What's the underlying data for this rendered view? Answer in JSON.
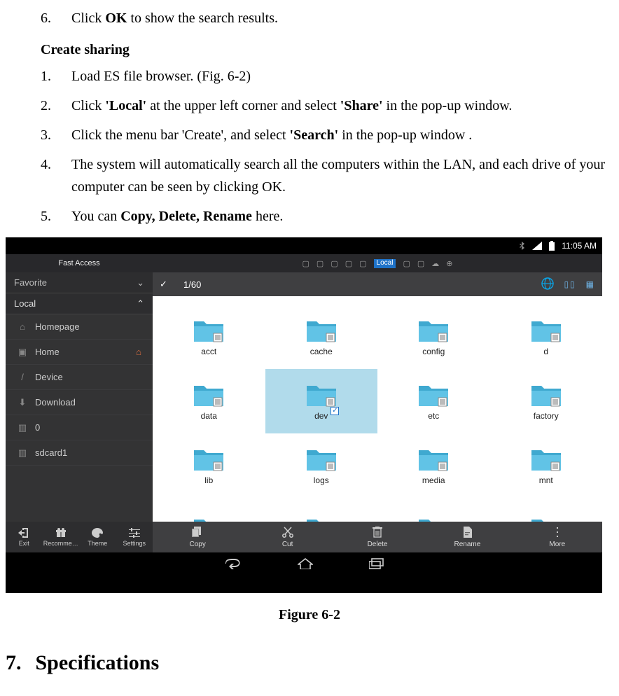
{
  "doc": {
    "step6": {
      "num": "6.",
      "pre": "Click ",
      "bold": "OK",
      "post": " to show the search results."
    },
    "create_heading": "Create sharing",
    "steps": [
      {
        "num": "1.",
        "text": "Load ES file browser. (Fig. 6-2)"
      },
      {
        "num": "2.",
        "pre": "Click ",
        "b1": "'Local'",
        "mid": " at the upper left corner and select ",
        "b2": "'Share'",
        "post": " in the pop-up window."
      },
      {
        "num": "3.",
        "pre": "Click the menu bar 'Create', and select ",
        "b1": "'Search'",
        "post": " in the pop-up window ."
      },
      {
        "num": "4.",
        "text": "The system will automatically search all the computers within the LAN, and each drive of your computer can be seen by clicking OK."
      },
      {
        "num": "5.",
        "pre": "You can ",
        "b1": "Copy, Delete, Rename",
        "post": " here."
      }
    ],
    "figure_caption": "Figure 6-2",
    "section7_num": "7.",
    "section7_title": "Specifications"
  },
  "fig": {
    "status_time": "11:05 AM",
    "fast_access": "Fast Access",
    "local_tag": "Local",
    "sidebar": {
      "favorite": "Favorite",
      "local": "Local",
      "items": [
        {
          "label": "Homepage"
        },
        {
          "label": "Home"
        },
        {
          "label": "Device"
        },
        {
          "label": "Download"
        },
        {
          "label": "0"
        },
        {
          "label": "sdcard1"
        }
      ],
      "bottom": [
        {
          "label": "Exit"
        },
        {
          "label": "Recomme…"
        },
        {
          "label": "Theme"
        },
        {
          "label": "Settings"
        }
      ]
    },
    "counter": "1/60",
    "folders": [
      {
        "name": "acct"
      },
      {
        "name": "cache"
      },
      {
        "name": "config"
      },
      {
        "name": "d"
      },
      {
        "name": "data"
      },
      {
        "name": "dev",
        "selected": true
      },
      {
        "name": "etc"
      },
      {
        "name": "factory"
      },
      {
        "name": "lib"
      },
      {
        "name": "logs"
      },
      {
        "name": "media"
      },
      {
        "name": "mnt"
      },
      {
        "name": ""
      },
      {
        "name": ""
      },
      {
        "name": ""
      },
      {
        "name": ""
      }
    ],
    "actions": [
      {
        "label": "Copy"
      },
      {
        "label": "Cut"
      },
      {
        "label": "Delete"
      },
      {
        "label": "Rename"
      },
      {
        "label": "More"
      }
    ]
  }
}
